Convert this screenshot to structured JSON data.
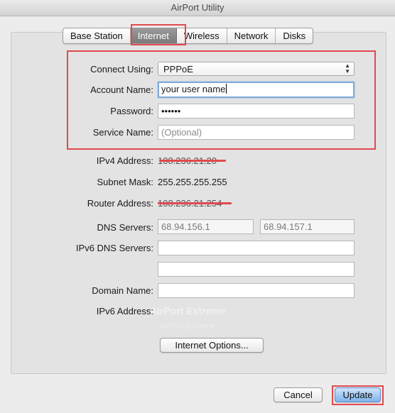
{
  "window": {
    "title": "AirPort Utility"
  },
  "tabs": [
    "Base Station",
    "Internet",
    "Wireless",
    "Network",
    "Disks"
  ],
  "selected_tab": "Internet",
  "form": {
    "connect_using_label": "Connect Using:",
    "connect_using_value": "PPPoE",
    "account_name_label": "Account Name:",
    "account_name_value": "your user name",
    "password_label": "Password:",
    "password_value": "••••••",
    "service_name_label": "Service Name:",
    "service_name_placeholder": "(Optional)"
  },
  "info": {
    "ipv4_label": "IPv4 Address:",
    "ipv4_value": "108.236.21.20",
    "subnet_label": "Subnet Mask:",
    "subnet_value": "255.255.255.255",
    "router_label": "Router Address:",
    "router_value": "108.236.21.254",
    "dns_label": "DNS Servers:",
    "dns1": "68.94.156.1",
    "dns2": "68.94.157.1",
    "ipv6_dns_label": "IPv6 DNS Servers:",
    "domain_label": "Domain Name:",
    "ipv6_label": "IPv6 Address:"
  },
  "watermark": {
    "name": "AirPort Extreme",
    "sub": "AirPort Extreme"
  },
  "buttons": {
    "internet_options": "Internet Options...",
    "cancel": "Cancel",
    "update": "Update"
  },
  "colors": {
    "highlight": "#e04a4f",
    "selected_tab": "#8a8a8a",
    "focus_ring": "#7fa8d9"
  }
}
